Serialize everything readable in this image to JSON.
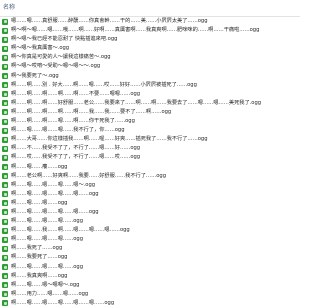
{
  "header": {
    "label": "名称"
  },
  "files": [
    "嗯……嗯……真舒服……醉醺……你真會幹……干的……美……小屄屄太美了……ogg",
    "啊～啊～嗯……嗯……哦……啊……好啊……真厲害啊……我真爽啊……肥咪咪的……啊……干痛啦……ogg",
    "啊～嗯～我已經不能忍耐了 快點插進來吧.ogg",
    "啊～嗯～我真厲害～.ogg",
    "啊～你真是可愛的人～讓我這樣痛苦～.ogg",
    "啊～嗯～哎唷～受助～嗯～嗯～～.ogg",
    "啊～我要死了～.ogg",
    "啊……啊……別 . 好大……啊……嗯……哎……好好……小屄屄被插死了……ogg",
    "啊……啊……啊……啊……啊……不要……嗯嗯……ogg",
    "啊……啊……啊……好舒服……老公……我要來了……啊……啊……我要去了……嗯……嗯……美死我了.ogg",
    "啊……啊……啊……啊……啊……我……我……要不了……啊……ogg",
    "啊……啊……啊……嗯……啊……你干死我了……ogg",
    "啊……嗯……嗯……嗯……我不行了，你……ogg",
    "啊……大哥……你這樣插我……啊……喔……好爽……插死我了……我不行了……ogg",
    "啊……不……我受不了了，不行了……嗯……好……ogg",
    "啊……哎……我受不了了，不行了……嗯……哎……ogg",
    "啊……嗯……癢……ogg",
    "啊……老公啊……好爽啊……我要……好舒服……我不行了……ogg",
    "啊……嗯……嗯……嗯……嗯～.ogg",
    "啊……嗯……嗯……嗯……嗯……ogg",
    "啊……嗯……嗯……ogg",
    "啊……嗯……嗯……嗯……嗯……ogg",
    "啊……嗯……嗯……嗯……ogg",
    "啊……嗯……我……啊……嗯……嗯……嗯……ogg",
    "啊……嗯……嗯……嗯……ogg",
    "啊……我死了……ogg",
    "啊……我要死了……ogg",
    "啊……嗯……嗯……嗯……ogg",
    "啊……我真爽啊……ogg",
    "啊……嗯……嗯～嗯嗯～.ogg",
    "啊……用力……嗯……嗯……ogg",
    "啊……嗯……嗯……嗯……嗯……嗯……ogg"
  ]
}
